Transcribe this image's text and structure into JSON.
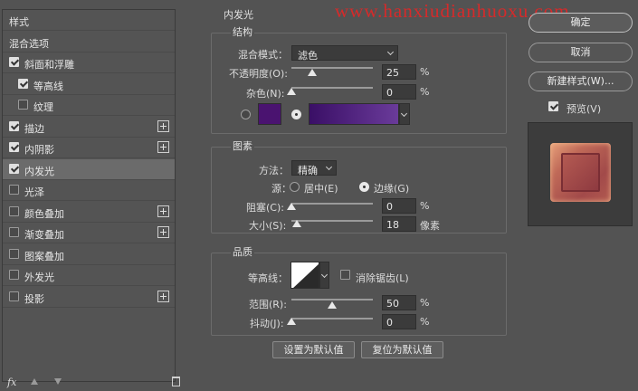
{
  "watermark": "www.hanxiudianhuoxu.com",
  "styles_panel": {
    "title": "样式",
    "items": [
      {
        "label": "混合选项",
        "checkbox": false,
        "checked": false,
        "plus": false,
        "indent": 0,
        "active": false
      },
      {
        "label": "斜面和浮雕",
        "checkbox": true,
        "checked": true,
        "plus": false,
        "indent": 0,
        "active": false
      },
      {
        "label": "等高线",
        "checkbox": true,
        "checked": true,
        "plus": false,
        "indent": 1,
        "active": false
      },
      {
        "label": "纹理",
        "checkbox": true,
        "checked": false,
        "plus": false,
        "indent": 1,
        "active": false
      },
      {
        "label": "描边",
        "checkbox": true,
        "checked": true,
        "plus": true,
        "indent": 0,
        "active": false
      },
      {
        "label": "内阴影",
        "checkbox": true,
        "checked": true,
        "plus": true,
        "indent": 0,
        "active": false
      },
      {
        "label": "内发光",
        "checkbox": true,
        "checked": true,
        "plus": false,
        "indent": 0,
        "active": true
      },
      {
        "label": "光泽",
        "checkbox": true,
        "checked": false,
        "plus": false,
        "indent": 0,
        "active": false
      },
      {
        "label": "颜色叠加",
        "checkbox": true,
        "checked": false,
        "plus": true,
        "indent": 0,
        "active": false
      },
      {
        "label": "渐变叠加",
        "checkbox": true,
        "checked": false,
        "plus": true,
        "indent": 0,
        "active": false
      },
      {
        "label": "图案叠加",
        "checkbox": true,
        "checked": false,
        "plus": false,
        "indent": 0,
        "active": false
      },
      {
        "label": "外发光",
        "checkbox": true,
        "checked": false,
        "plus": false,
        "indent": 0,
        "active": false
      },
      {
        "label": "投影",
        "checkbox": true,
        "checked": false,
        "plus": true,
        "indent": 0,
        "active": false
      }
    ],
    "footer_fx": "fx"
  },
  "inner_glow": {
    "title": "内发光",
    "structure": {
      "title": "结构",
      "blend_mode_label": "混合模式：",
      "blend_mode_value": "滤色",
      "opacity_label": "不透明度(O):",
      "opacity_value": "25",
      "opacity_unit": "%",
      "opacity_level": 0.25,
      "noise_label": "杂色(N):",
      "noise_value": "0",
      "noise_unit": "%",
      "noise_level": 0,
      "solid_color": "#4a1370",
      "gradient_colors": [
        "#3a0f66",
        "#6a3b9a"
      ]
    },
    "elements": {
      "title": "图素",
      "method_label": "方法：",
      "method_value": "精确",
      "source_label": "源：",
      "source_center": "居中(E)",
      "source_edge": "边缘(G)",
      "choke_label": "阻塞(C):",
      "choke_value": "0",
      "choke_unit": "%",
      "choke_level": 0,
      "size_label": "大小(S):",
      "size_value": "18",
      "size_unit": "像素",
      "size_level": 0.07
    },
    "quality": {
      "title": "品质",
      "contour_label": "等高线：",
      "antialias_label": "消除锯齿(L)",
      "antialias_checked": false,
      "range_label": "范围(R):",
      "range_value": "50",
      "range_unit": "%",
      "range_level": 0.5,
      "jitter_label": "抖动(J):",
      "jitter_value": "0",
      "jitter_unit": "%",
      "jitter_level": 0
    },
    "make_default_label": "设置为默认值",
    "reset_default_label": "复位为默认值"
  },
  "actions": {
    "ok_label": "确定",
    "cancel_label": "取消",
    "new_style_label": "新建样式(W)...",
    "preview_label": "预览(V)",
    "preview_checked": true
  },
  "colors": {
    "background": "#535353",
    "active_row": "#6b6b6b",
    "preview_bg": "#3c3c3c",
    "watermark": "#e12727"
  }
}
